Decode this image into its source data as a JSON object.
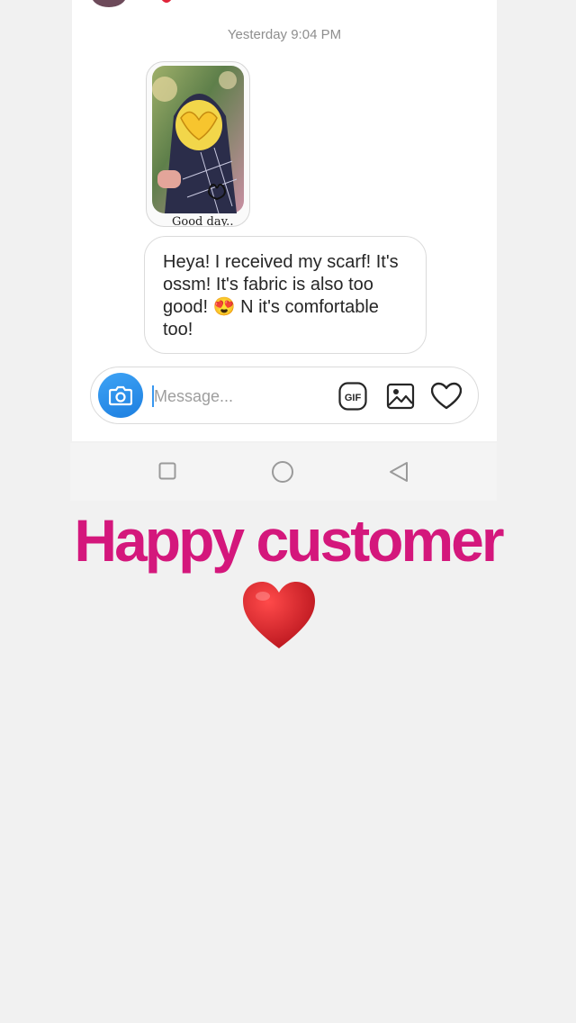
{
  "chat": {
    "timestamp": "Yesterday 9:04 PM",
    "photo_caption": "Good day..",
    "message_text": "Heya! I received my scarf! It's ossm! It's fabric is also too good! 😍 N it's comfortable too!"
  },
  "composer": {
    "placeholder": "Message...",
    "gif_label": "GIF"
  },
  "overlay": {
    "caption": "Happy customer",
    "heart_emoji": "❤️"
  },
  "colors": {
    "caption": "#d4177c",
    "camera_button": "#1d7fe0",
    "heart": "#d81b2a"
  },
  "icons": [
    "camera-icon",
    "gif-icon",
    "image-icon",
    "heart-outline-icon",
    "nav-square-icon",
    "nav-home-circle-icon",
    "nav-back-triangle-icon"
  ]
}
